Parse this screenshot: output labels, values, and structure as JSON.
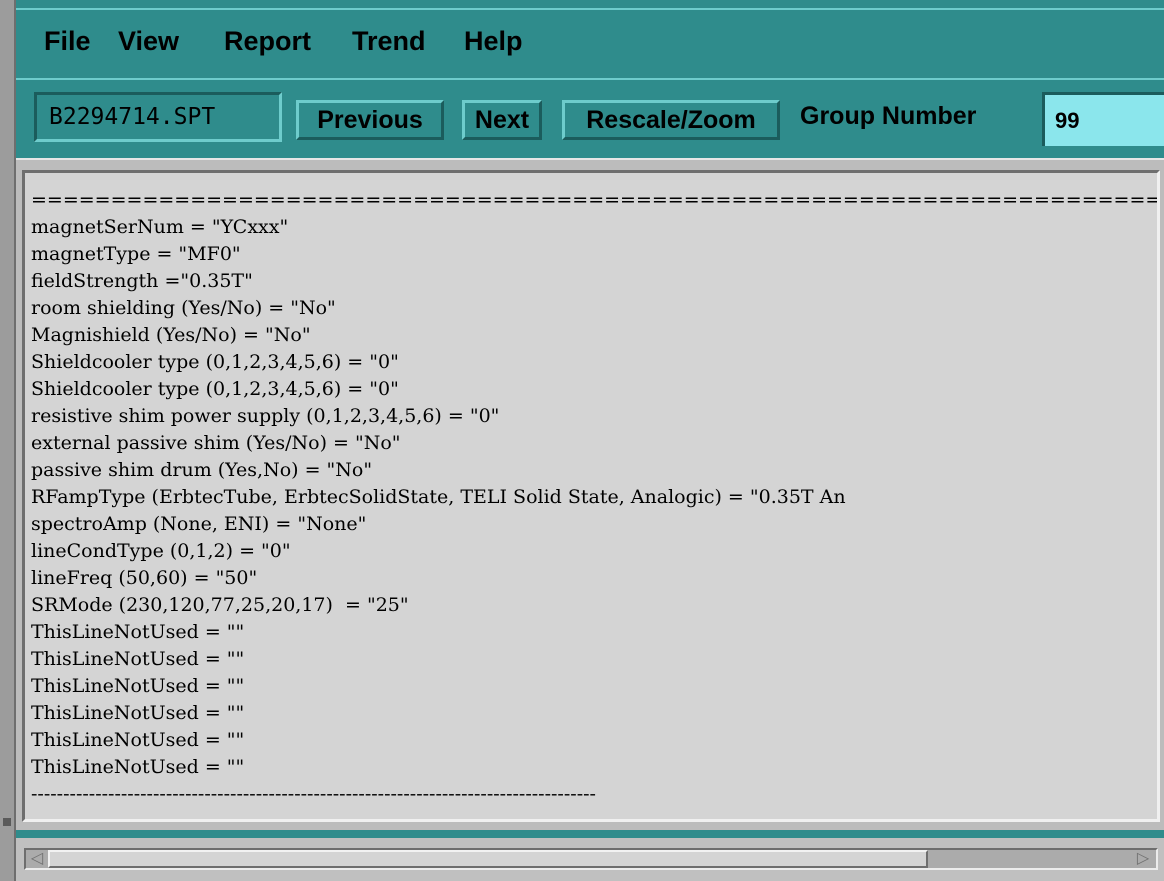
{
  "menu": {
    "items": [
      "File",
      "View",
      "Report",
      "Trend",
      "Help"
    ]
  },
  "toolbar": {
    "filename": "B2294714.SPT",
    "previous_label": "Previous",
    "next_label": "Next",
    "rescale_label": "Rescale/Zoom",
    "group_label": "Group Number",
    "group_value": "99"
  },
  "content": {
    "lines": [
      "========================================================================================",
      "magnetSerNum = \"YCxxx\"",
      "magnetType = \"MF0\"",
      "fieldStrength =\"0.35T\"",
      "room shielding (Yes/No) = \"No\"",
      "Magnishield (Yes/No) = \"No\"",
      "Shieldcooler type (0,1,2,3,4,5,6) = \"0\"",
      "Shieldcooler type (0,1,2,3,4,5,6) = \"0\"",
      "resistive shim power supply (0,1,2,3,4,5,6) = \"0\"",
      "external passive shim (Yes/No) = \"No\"",
      "passive shim drum (Yes,No) = \"No\"",
      "RFampType (ErbtecTube, ErbtecSolidState, TELI Solid State, Analogic) = \"0.35T An",
      "spectroAmp (None, ENI) = \"None\"",
      "lineCondType (0,1,2) = \"0\"",
      "lineFreq (50,60) = \"50\"",
      "SRMode (230,120,77,25,20,17)  = \"25\"",
      "ThisLineNotUsed = \"\"",
      "ThisLineNotUsed = \"\"",
      "ThisLineNotUsed = \"\"",
      "ThisLineNotUsed = \"\"",
      "ThisLineNotUsed = \"\"",
      "ThisLineNotUsed = \"\"",
      "----------------------------------------------------------------------------------------"
    ]
  },
  "scrollbar": {
    "left_icon": "arrow-left-icon",
    "right_icon": "arrow-right-icon"
  }
}
